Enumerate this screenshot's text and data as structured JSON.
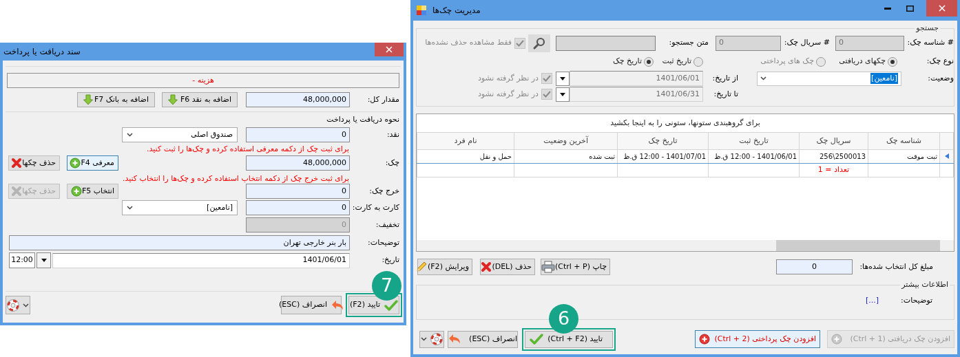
{
  "left_window": {
    "title": "سند دریافت یا پرداخت",
    "category": "هزینه -",
    "total": {
      "label": "مقدار کل:",
      "value": "48,000,000"
    },
    "add_buttons": [
      {
        "label": "اضافه به نقد F6"
      },
      {
        "label": "اضافه به بانک F7"
      }
    ],
    "section_title": "نحوه دریافت یا پرداخت",
    "cash": {
      "label": "نقد:",
      "value": "0",
      "account": "صندوق اصلی"
    },
    "check_hint": "برای ثبت چک از دکمه معرفی استفاده کرده و چک‌ها را ثبت کنید.",
    "check": {
      "label": "چک:",
      "value": "48,000,000"
    },
    "check_buttons": [
      {
        "label": "معرفی F4",
        "kind": "add",
        "disabled": false,
        "focused": true
      },
      {
        "label": "حذف چکها",
        "kind": "delete",
        "disabled": false,
        "focused": false
      }
    ],
    "check_out_hint": "برای ثبت خرج چک از دکمه انتخاب استفاده کرده و چک‌ها را انتخاب کنید.",
    "check_out": {
      "label": "خرج چک:",
      "value": "0"
    },
    "check_out_buttons": [
      {
        "label": "انتخاب F5",
        "kind": "add",
        "disabled": false,
        "focused": false
      },
      {
        "label": "حذف چکها",
        "kind": "delete",
        "disabled": true,
        "focused": false
      }
    ],
    "card": {
      "label": "کارت به کارت:",
      "value": "0",
      "account": "[نامعین]"
    },
    "discount": {
      "label": "تخفیف:",
      "value": "0"
    },
    "description": {
      "label": "توضیحات:",
      "value": "بار بنر خارجی تهران"
    },
    "date": {
      "label": "تاریخ:",
      "value": "1401/06/01",
      "time": "12:00"
    },
    "footer_buttons": [
      {
        "label": "تایید (F2)",
        "kind": "confirm",
        "callout": "7"
      },
      {
        "label": "انصراف (ESC)",
        "kind": "cancel"
      }
    ]
  },
  "right_window": {
    "title": "مدیریت چک‌ها",
    "search": {
      "legend": "جستجو",
      "check_id": {
        "label": "# شناسه چک:",
        "value": "0"
      },
      "serial": {
        "label": "# سریال چک:",
        "value": "0"
      },
      "text": {
        "label": "متن جستجو:"
      },
      "only_active": {
        "label": "فقط مشاهده حذف نشده‌ها",
        "checked": true
      },
      "type_label": "نوع چک:",
      "type_options": [
        {
          "label": "چکهای دریافتی",
          "selected": true
        },
        {
          "label": "چک های پرداختی",
          "selected": false
        }
      ],
      "date_options": [
        {
          "label": "تاریخ ثبت",
          "selected": false
        },
        {
          "label": "تاریخ چک",
          "selected": true
        }
      ],
      "status": {
        "label": "وضعیت:",
        "value": "[نامعین]"
      },
      "dates": [
        {
          "label": "از تاریخ:",
          "value": "1401/06/01",
          "ignore_label": "در نظر گرفته نشود",
          "ignore_checked": true
        },
        {
          "label": "تا تاریخ:",
          "value": "1401/06/31",
          "ignore_label": "در نظر گرفته نشود",
          "ignore_checked": true
        }
      ]
    },
    "grid": {
      "group_hint": "برای گروهبندی ستونها، ستونی را به اینجا بکشید",
      "columns": [
        {
          "label": "شناسه چک"
        },
        {
          "label": "سریال چک",
          "summary": "تعداد = 1"
        },
        {
          "label": "تاریخ ثبت"
        },
        {
          "label": "تاریخ چک"
        },
        {
          "label": "آخرین وضعیت"
        },
        {
          "label": "نام فرد"
        }
      ],
      "rows": [
        {
          "selected": true,
          "cells": [
            "ثبت موقت",
            "256\\2500013",
            "1401/06/01 - 12:00 ق.ظ",
            "1401/07/01 - 12:00 ق.ظ",
            "ثبت شده",
            "حمل و نقل"
          ]
        }
      ]
    },
    "selected_total": {
      "label": "مبلغ کل انتخاب شده‌ها:",
      "value": "0"
    },
    "toolbar_buttons": [
      {
        "label": "چاپ (Ctrl + P)",
        "kind": "print"
      },
      {
        "label": "حذف (DEL)",
        "kind": "delete"
      },
      {
        "label": "ویرایش (F2)",
        "kind": "edit"
      }
    ],
    "more_info": {
      "legend": "اطلاعات بیشتر",
      "description_label": "توضیحات:",
      "description_value": "[...]"
    },
    "add_buttons": [
      {
        "label": "افزودن چک دریافتی (Ctrl + 1)",
        "kind": "receive",
        "disabled": true,
        "focused": false
      },
      {
        "label": "افزودن چک پرداختی (Ctrl + 2)",
        "kind": "pay",
        "disabled": false,
        "focused": true
      }
    ],
    "footer_buttons": [
      {
        "label": "تایید (Ctrl + F2)",
        "kind": "confirm",
        "callout": "6"
      },
      {
        "label": "انصراف (ESC)",
        "kind": "cancel"
      }
    ]
  }
}
